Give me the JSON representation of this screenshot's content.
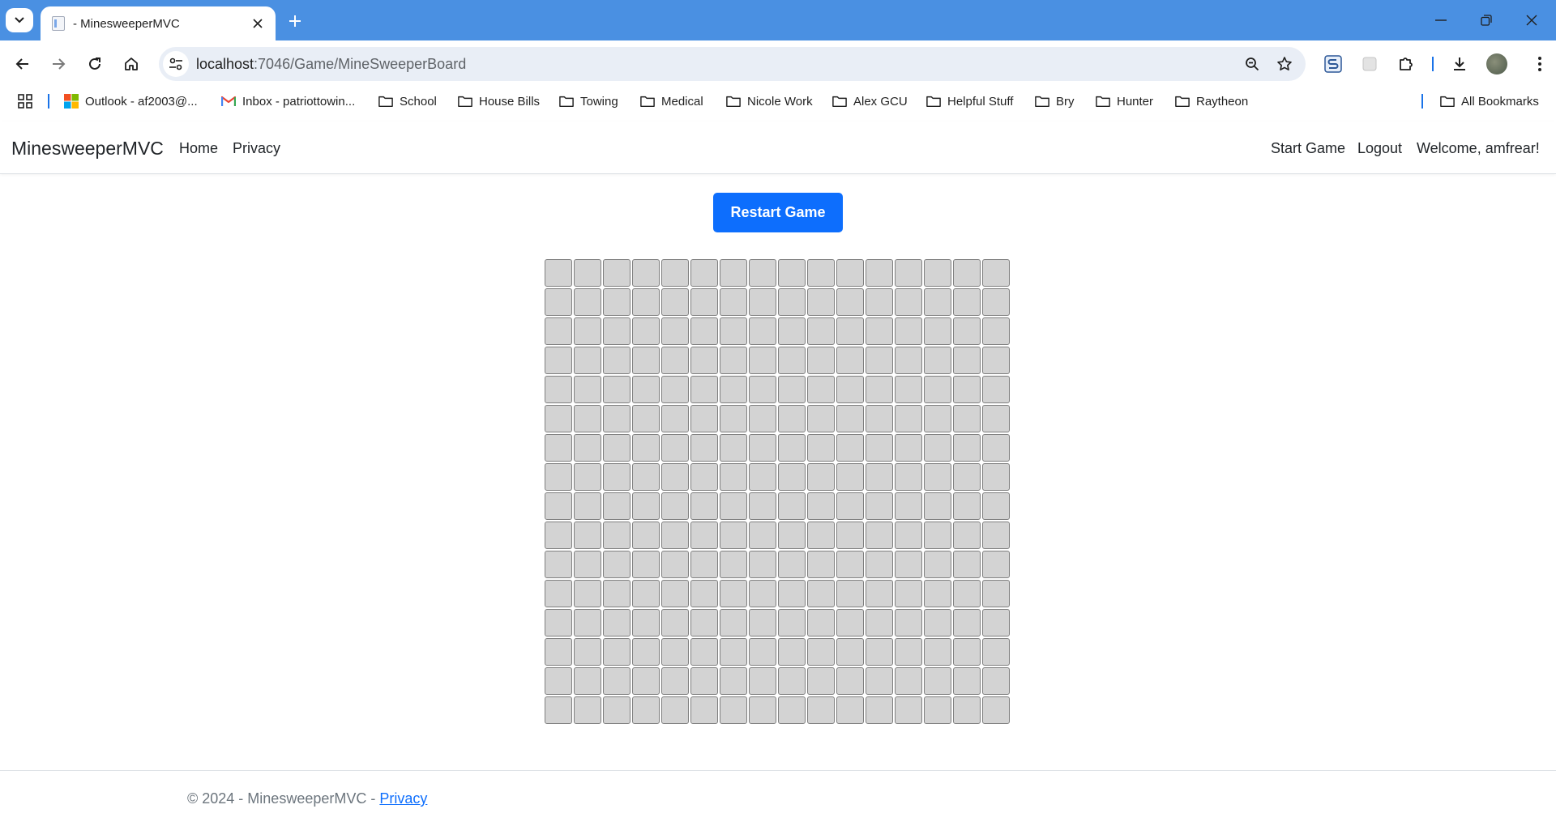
{
  "browser": {
    "tab_title": "- MinesweeperMVC",
    "url_host": "localhost",
    "url_path": ":7046/Game/MineSweeperBoard",
    "bookmarks": [
      {
        "label": "Outlook - af2003@...",
        "icon": "microsoft-icon"
      },
      {
        "label": "Inbox - patriottowin...",
        "icon": "gmail-icon"
      },
      {
        "label": "School",
        "icon": "folder-icon"
      },
      {
        "label": "House Bills",
        "icon": "folder-icon"
      },
      {
        "label": "Towing",
        "icon": "folder-icon"
      },
      {
        "label": "Medical",
        "icon": "folder-icon"
      },
      {
        "label": "Nicole Work",
        "icon": "folder-icon"
      },
      {
        "label": "Alex GCU",
        "icon": "folder-icon"
      },
      {
        "label": "Helpful Stuff",
        "icon": "folder-icon"
      },
      {
        "label": "Bry",
        "icon": "folder-icon"
      },
      {
        "label": "Hunter",
        "icon": "folder-icon"
      },
      {
        "label": "Raytheon",
        "icon": "folder-icon"
      }
    ],
    "all_bookmarks": "All Bookmarks"
  },
  "navbar": {
    "brand": "MinesweeperMVC",
    "links": [
      "Home",
      "Privacy"
    ],
    "right_links": [
      "Start Game",
      "Logout"
    ],
    "welcome": "Welcome, amfrear!"
  },
  "game": {
    "restart_label": "Restart Game",
    "rows": 16,
    "cols": 16
  },
  "footer": {
    "text": "© 2024 - MinesweeperMVC - ",
    "link": "Privacy"
  },
  "colors": {
    "tab_strip": "#4a90e2",
    "primary": "#0d6efd",
    "cell": "#d3d3d3"
  }
}
